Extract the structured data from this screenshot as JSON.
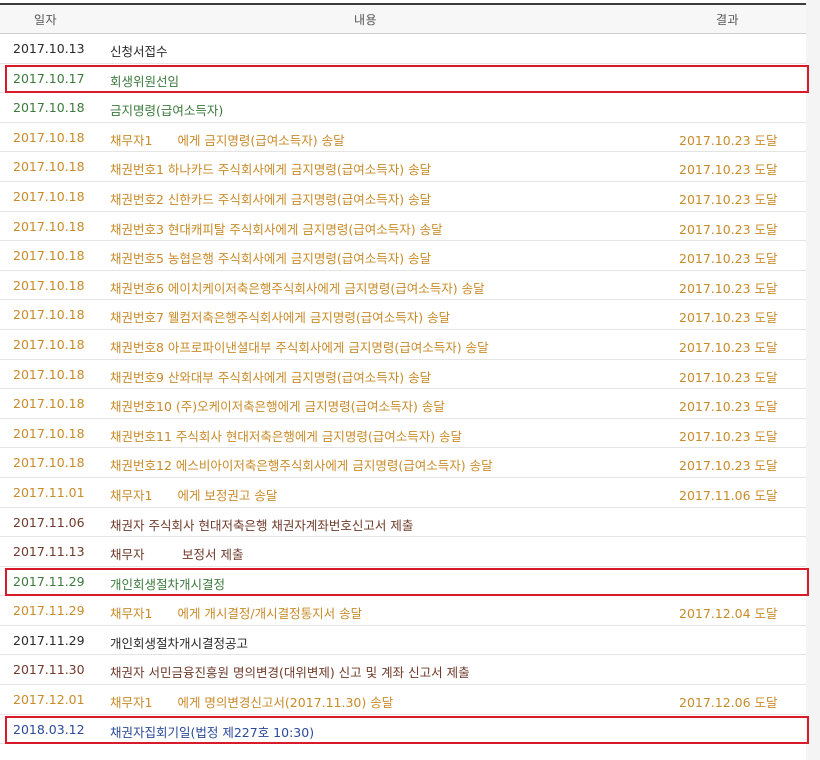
{
  "header": {
    "date": "일자",
    "content": "내용",
    "result": "결과"
  },
  "rows": [
    {
      "date": "2017.10.13",
      "content": "신청서접수",
      "result": "",
      "color": "black"
    },
    {
      "date": "2017.10.17",
      "content": "회생위원선임",
      "result": "",
      "color": "green",
      "highlight": true
    },
    {
      "date": "2017.10.18",
      "content": "금지명령(급여소득자)",
      "result": "",
      "color": "green"
    },
    {
      "date": "2017.10.18",
      "content": "채무자1　　에게 금지명령(급여소득자) 송달",
      "result": "2017.10.23 도달",
      "color": "orange"
    },
    {
      "date": "2017.10.18",
      "content": "채권번호1 하나카드 주식회사에게 금지명령(급여소득자) 송달",
      "result": "2017.10.23 도달",
      "color": "orange"
    },
    {
      "date": "2017.10.18",
      "content": "채권번호2 신한카드 주식회사에게 금지명령(급여소득자) 송달",
      "result": "2017.10.23 도달",
      "color": "orange"
    },
    {
      "date": "2017.10.18",
      "content": "채권번호3 현대캐피탈 주식회사에게 금지명령(급여소득자) 송달",
      "result": "2017.10.23 도달",
      "color": "orange"
    },
    {
      "date": "2017.10.18",
      "content": "채권번호5 농협은행 주식회사에게 금지명령(급여소득자) 송달",
      "result": "2017.10.23 도달",
      "color": "orange"
    },
    {
      "date": "2017.10.18",
      "content": "채권번호6 에이치케이저축은행주식회사에게 금지명령(급여소득자) 송달",
      "result": "2017.10.23 도달",
      "color": "orange"
    },
    {
      "date": "2017.10.18",
      "content": "채권번호7 웰컴저축은행주식회사에게 금지명령(급여소득자) 송달",
      "result": "2017.10.23 도달",
      "color": "orange"
    },
    {
      "date": "2017.10.18",
      "content": "채권번호8 아프로파이낸셜대부 주식회사에게 금지명령(급여소득자) 송달",
      "result": "2017.10.23 도달",
      "color": "orange"
    },
    {
      "date": "2017.10.18",
      "content": "채권번호9 산와대부 주식회사에게 금지명령(급여소득자) 송달",
      "result": "2017.10.23 도달",
      "color": "orange"
    },
    {
      "date": "2017.10.18",
      "content": "채권번호10 (주)오케이저축은행에게 금지명령(급여소득자) 송달",
      "result": "2017.10.23 도달",
      "color": "orange"
    },
    {
      "date": "2017.10.18",
      "content": "채권번호11 주식회사 현대저축은행에게 금지명령(급여소득자) 송달",
      "result": "2017.10.23 도달",
      "color": "orange"
    },
    {
      "date": "2017.10.18",
      "content": "채권번호12 에스비아이저축은행주식회사에게 금지명령(급여소득자) 송달",
      "result": "2017.10.23 도달",
      "color": "orange"
    },
    {
      "date": "2017.11.01",
      "content": "채무자1　　에게 보정권고 송달",
      "result": "2017.11.06 도달",
      "color": "orange"
    },
    {
      "date": "2017.11.06",
      "content": "채권자 주식회사 현대저축은행 채권자계좌번호신고서 제출",
      "result": "",
      "color": "brown"
    },
    {
      "date": "2017.11.13",
      "content": "채무자　　　보정서 제출",
      "result": "",
      "color": "brown"
    },
    {
      "date": "2017.11.29",
      "content": "개인회생절차개시결정",
      "result": "",
      "color": "green",
      "highlight": true
    },
    {
      "date": "2017.11.29",
      "content": "채무자1　　에게 개시결정/개시결정통지서 송달",
      "result": "2017.12.04 도달",
      "color": "orange"
    },
    {
      "date": "2017.11.29",
      "content": "개인회생절차개시결정공고",
      "result": "",
      "color": "black"
    },
    {
      "date": "2017.11.30",
      "content": "채권자 서민금융진흥원 명의변경(대위변제) 신고 및 계좌 신고서 제출",
      "result": "",
      "color": "brown"
    },
    {
      "date": "2017.12.01",
      "content": "채무자1　　에게 명의변경신고서(2017.11.30) 송달",
      "result": "2017.12.06 도달",
      "color": "orange"
    },
    {
      "date": "2018.03.12",
      "content": "채권자집회기일(법정 제227호 10:30)",
      "result": "",
      "color": "blue",
      "highlight": true
    }
  ],
  "colors": {
    "highlight_border": "#d91a2a",
    "header_bg": "#f7f7f7",
    "text_green": "#3c7a3c",
    "text_orange": "#c98b2a",
    "text_brown": "#6f3a2a",
    "text_blue": "#2a4a9a"
  }
}
